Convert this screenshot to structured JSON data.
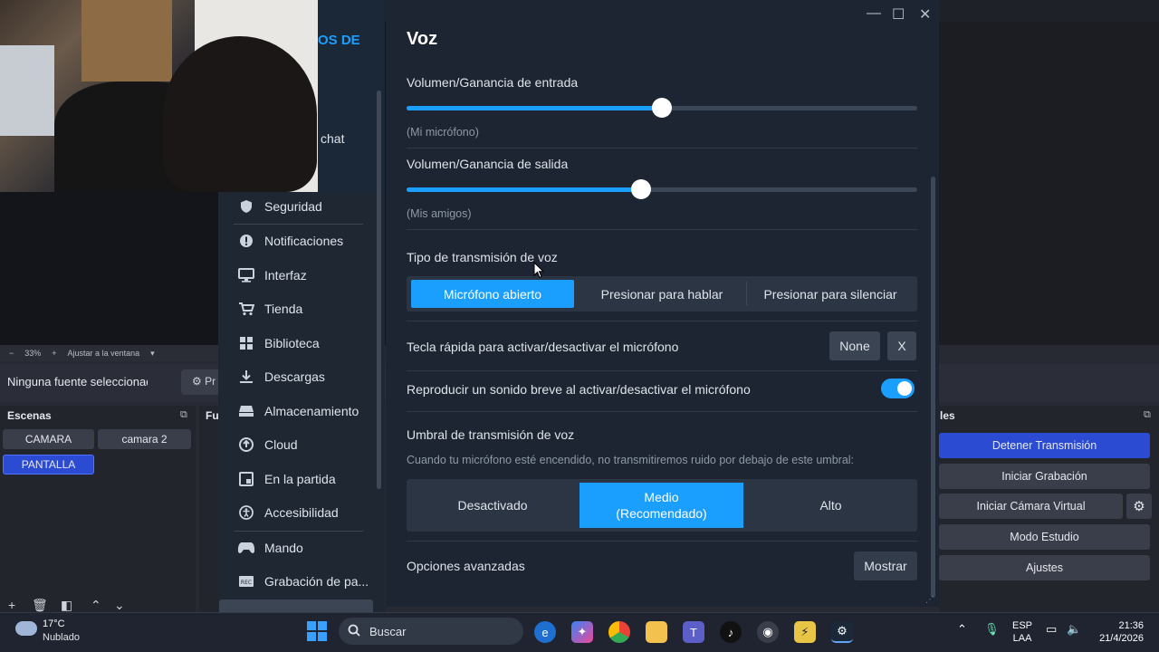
{
  "obs": {
    "zoom": "33%",
    "fit_label": "Ajustar a la ventana",
    "no_source": "Ninguna fuente seleccionada",
    "props_label": "Pr",
    "scenes_title": "Escenas",
    "sources_title": "Fu",
    "controls_title": "les",
    "scenes": [
      "CAMARA",
      "camara 2",
      "PANTALLA"
    ],
    "controls": {
      "stop_stream": "Detener Transmisión",
      "start_record": "Iniciar Grabación",
      "virtual_cam": "Iniciar Cámara Virtual",
      "studio_mode": "Modo Estudio",
      "settings": "Ajustes"
    }
  },
  "steam": {
    "sidebar_header_fragment": "OS DE",
    "sidebar_chat_fragment": "chat",
    "sidebar_items": [
      {
        "label": "Seguridad",
        "icon": "shield-icon"
      },
      {
        "label": "Notificaciones",
        "icon": "alert-icon"
      },
      {
        "label": "Interfaz",
        "icon": "monitor-icon"
      },
      {
        "label": "Tienda",
        "icon": "cart-icon"
      },
      {
        "label": "Biblioteca",
        "icon": "grid-icon"
      },
      {
        "label": "Descargas",
        "icon": "download-icon"
      },
      {
        "label": "Almacenamiento",
        "icon": "drive-icon"
      },
      {
        "label": "Cloud",
        "icon": "cloud-icon"
      },
      {
        "label": "En la partida",
        "icon": "ingame-icon"
      },
      {
        "label": "Accesibilidad",
        "icon": "accessibility-icon"
      },
      {
        "label": "Mando",
        "icon": "controller-icon"
      },
      {
        "label": "Grabación de pa...",
        "icon": "rec-icon"
      }
    ],
    "voice": {
      "title": "Voz",
      "input_label": "Volumen/Ganancia de entrada",
      "input_sub": "(Mi micrófono)",
      "input_level": 0.5,
      "output_label": "Volumen/Ganancia de salida",
      "output_sub": "(Mis amigos)",
      "output_level": 0.46,
      "transmission_label": "Tipo de transmisión de voz",
      "transmission_options": [
        "Micrófono abierto",
        "Presionar para hablar",
        "Presionar para silenciar"
      ],
      "transmission_selected": "Micrófono abierto",
      "hotkey_label": "Tecla rápida para activar/desactivar el micrófono",
      "hotkey_value": "None",
      "hotkey_clear": "X",
      "sound_label": "Reproducir un sonido breve al activar/desactivar el micrófono",
      "sound_enabled": true,
      "threshold_label": "Umbral de transmisión de voz",
      "threshold_desc": "Cuando tu micrófono esté encendido, no transmitiremos ruido por debajo de este umbral:",
      "threshold_options": [
        "Desactivado",
        "Medio\n(Recomendado)",
        "Alto"
      ],
      "threshold_selected": "Medio (Recomendado)",
      "advanced_label": "Opciones avanzadas",
      "advanced_button": "Mostrar"
    }
  },
  "taskbar": {
    "temp": "17°C",
    "weather": "Nublado",
    "search_placeholder": "Buscar",
    "lang_top": "ESP",
    "lang_bottom": "LAA",
    "time": "21:36",
    "date": "21/4/2026"
  },
  "colors": {
    "accent": "#1a9fff",
    "obs_accent": "#2b4bd3",
    "panel_bg": "#1c2531"
  }
}
